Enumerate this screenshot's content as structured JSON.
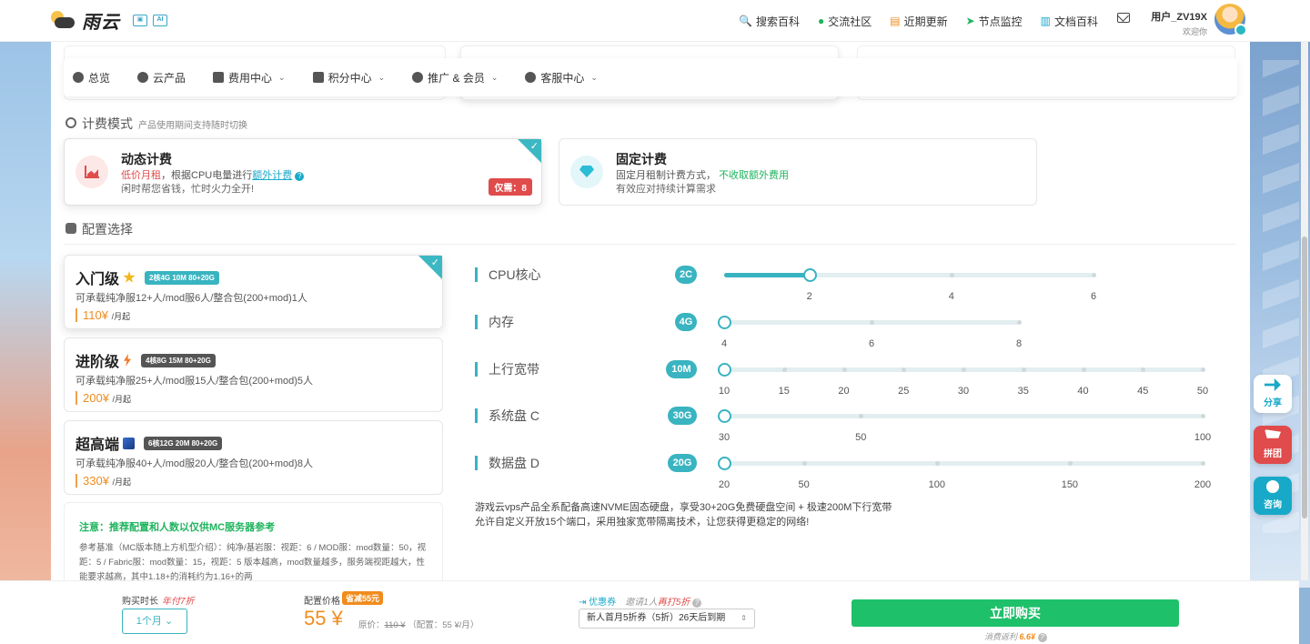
{
  "topbar": {
    "logo_text": "雨云",
    "nav": [
      {
        "icon": "search-icon",
        "label": "搜索百科"
      },
      {
        "icon": "wechat-icon",
        "label": "交流社区"
      },
      {
        "icon": "calendar-icon",
        "label": "近期更新"
      },
      {
        "icon": "send-icon",
        "label": "节点监控"
      },
      {
        "icon": "book-icon",
        "label": "文档百科"
      }
    ],
    "user_name": "用户_ZV19X",
    "greeting": "欢迎你"
  },
  "subnav": {
    "items": [
      {
        "label": "总览",
        "dropdown": false
      },
      {
        "label": "云产品",
        "dropdown": false
      },
      {
        "label": "费用中心",
        "dropdown": true
      },
      {
        "label": "积分中心",
        "dropdown": true
      },
      {
        "label": "推广 & 会员",
        "dropdown": true
      },
      {
        "label": "客服中心",
        "dropdown": true
      }
    ]
  },
  "billing": {
    "title": "计费模式",
    "hint": "产品使用期间支持随时切换",
    "dynamic": {
      "title": "动态计费",
      "highlight": "低价月租",
      "text1": "，根据CPU电量进行",
      "link": "额外计费",
      "line2": "闲时帮您省钱，忙时火力全开!",
      "badge": "仅需：8"
    },
    "fixed": {
      "title": "固定计费",
      "text1": "固定月租制计费方式，",
      "highlight": "不收取额外费用",
      "line2": "有效应对持续计算需求"
    }
  },
  "config": {
    "title": "配置选择",
    "plans": [
      {
        "name": "入门级",
        "spec": "2核4G 10M 80+20G",
        "desc": "可承载纯净服12+人/mod服6人/整合包(200+mod)1人",
        "price": "110¥",
        "unit": "/月起"
      },
      {
        "name": "进阶级",
        "spec": "4核8G 15M 80+20G",
        "desc": "可承载纯净服25+人/mod服15人/整合包(200+mod)5人",
        "price": "200¥",
        "unit": "/月起"
      },
      {
        "name": "超高端",
        "spec": "6核12G 20M 80+20G",
        "desc": "可承载纯净服40+人/mod服20人/整合包(200+mod)8人",
        "price": "330¥",
        "unit": "/月起"
      }
    ],
    "note_title": "注意：推荐配置和人数以仅供MC服务器参考",
    "note_text": "参考基准（MC版本随上方机型介绍）：纯净/基岩服：视距：6 / MOD服：mod数量：50，视距：5 / Fabric服：mod数量：15，视距：5 版本越高，mod数量越多，服务端视距越大，性能要求越高，其中1.18+的消耗约为1.16+的两"
  },
  "sliders": [
    {
      "label": "CPU核心",
      "value": "2C",
      "min": 0.8,
      "max": 6,
      "current": 2,
      "ticks": [
        "2",
        "4",
        "6"
      ],
      "tick_values": [
        2,
        4,
        6
      ]
    },
    {
      "label": "内存",
      "value": "4G",
      "min": 4,
      "max": 8,
      "current": 4,
      "ticks": [
        "4",
        "6",
        "8"
      ],
      "tick_values": [
        4,
        6,
        8
      ]
    },
    {
      "label": "上行宽带",
      "value": "10M",
      "min": 10,
      "max": 50,
      "current": 10,
      "ticks": [
        "10",
        "15",
        "20",
        "25",
        "30",
        "35",
        "40",
        "45",
        "50"
      ],
      "tick_values": [
        10,
        15,
        20,
        25,
        30,
        35,
        40,
        45,
        50
      ]
    },
    {
      "label": "系统盘 C",
      "value": "30G",
      "min": 30,
      "max": 100,
      "current": 30,
      "ticks": [
        "30",
        "50",
        "100"
      ],
      "tick_values": [
        30,
        50,
        100
      ]
    },
    {
      "label": "数据盘 D",
      "value": "20G",
      "min": 20,
      "max": 200,
      "current": 20,
      "ticks": [
        "20",
        "50",
        "100",
        "150",
        "200"
      ],
      "tick_values": [
        20,
        50,
        100,
        150,
        200
      ]
    }
  ],
  "info": {
    "line1": "游戏云vps产品全系配备高速NVME固态硬盘，享受30+20G免费硬盘空间 + 极速200M下行宽带",
    "line2": "允许自定义开放15个端口，采用独家宽带隔离技术，让您获得更稳定的网络!"
  },
  "side_buttons": [
    {
      "label": "分享",
      "color": "#19a9c8"
    },
    {
      "label": "拼团",
      "color": "#e04b4b"
    },
    {
      "label": "咨询",
      "color": "#19a9c8"
    }
  ],
  "bottom": {
    "duration_label": "购买时长",
    "duration_promo": "年付7折",
    "duration_value": "1个月",
    "price_label": "配置价格",
    "save_tag": "省减55元",
    "price": "55 ¥",
    "orig_prefix": "原价：",
    "orig_price": "110 ¥",
    "config_note": "（配置：55 ¥/月）",
    "coupon_label": "优惠券",
    "coupon_invite": "邀请1人",
    "coupon_invite_bold": "再打5折",
    "coupon_value": "新人首月5折券（5折）26天后到期",
    "buy_label": "立即购买",
    "buy_note_prefix": "消费返利",
    "buy_note_value": "6.6¥"
  }
}
